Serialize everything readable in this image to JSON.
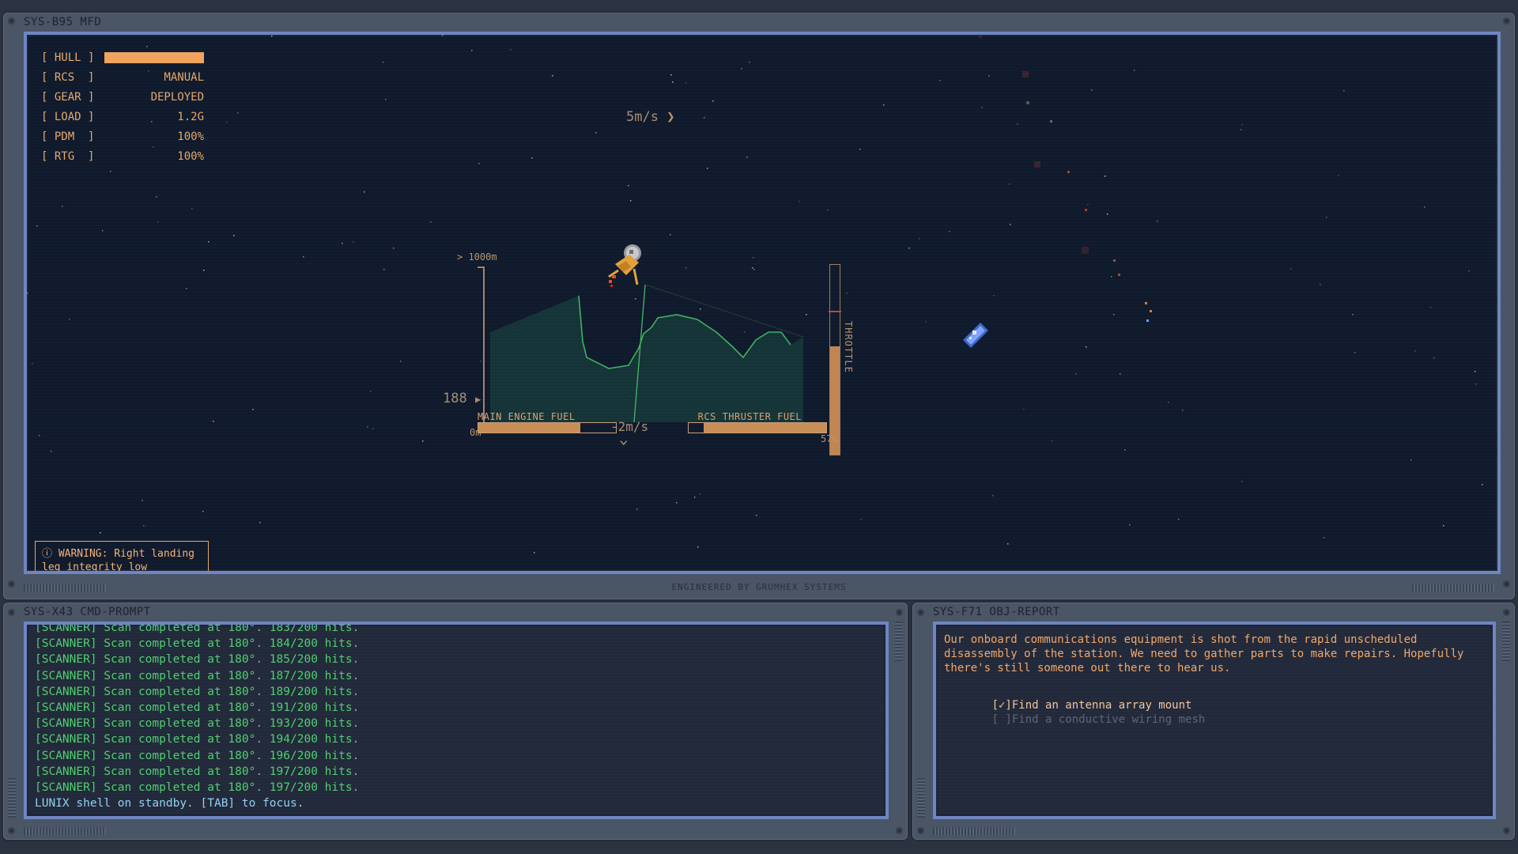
{
  "mfd": {
    "title": "SYS-B95 MFD",
    "footer": "ENGINEERED BY GRUMHEX SYSTEMS",
    "status": [
      {
        "key": "[ HULL ]",
        "value": ""
      },
      {
        "key": "[ RCS  ]",
        "value": "MANUAL"
      },
      {
        "key": "[ GEAR ]",
        "value": "DEPLOYED"
      },
      {
        "key": "[ LOAD ]",
        "value": "1.2G"
      },
      {
        "key": "[ PDM  ]",
        "value": "100%"
      },
      {
        "key": "[ RTG  ]",
        "value": "100%"
      }
    ],
    "hull_level": 1.0,
    "horizontal_speed": "5m/s",
    "vertical_speed": "-2m/s",
    "altitude_max": "> 1000m",
    "altitude_current": "188",
    "altitude_min": "0m",
    "main_fuel_label": "MAIN ENGINE FUEL",
    "main_fuel_level": 0.74,
    "rcs_fuel_label": "RCS THRUSTER FUEL",
    "rcs_fuel_level": 0.89,
    "throttle_label": "THROTTLE",
    "throttle_value": "57%",
    "throttle_level": 0.57,
    "warning_icon": "alert-circle-icon",
    "warning_text": "ⓘ WARNING: Right landing leg integrity low"
  },
  "cmd": {
    "title": "SYS-X43 CMD-PROMPT",
    "log": [
      "[SCANNER] Scan completed at 180°. 183/200 hits.",
      "[SCANNER] Scan completed at 180°. 184/200 hits.",
      "[SCANNER] Scan completed at 180°. 185/200 hits.",
      "[SCANNER] Scan completed at 180°. 187/200 hits.",
      "[SCANNER] Scan completed at 180°. 189/200 hits.",
      "[SCANNER] Scan completed at 180°. 191/200 hits.",
      "[SCANNER] Scan completed at 180°. 193/200 hits.",
      "[SCANNER] Scan completed at 180°. 194/200 hits.",
      "[SCANNER] Scan completed at 180°. 196/200 hits.",
      "[SCANNER] Scan completed at 180°. 197/200 hits.",
      "[SCANNER] Scan completed at 180°. 197/200 hits."
    ],
    "shell": "LUNIX shell on standby. [TAB] to focus."
  },
  "obj": {
    "title": "SYS-F71 OBJ-REPORT",
    "report": "Our onboard communications equipment is shot from the rapid unscheduled disassembly of the station. We need to gather parts to make repairs. Hopefully there's still someone out there to hear us.",
    "tasks": [
      {
        "mark": "[✓]",
        "text": "Find an antenna array mount",
        "done": true
      },
      {
        "mark": "[ ]",
        "text": "Find a conductive wiring mesh",
        "done": false
      }
    ]
  },
  "colors": {
    "accent": "#e7a86b",
    "terrain_line": "#3fb060",
    "log_text": "#4ed06f",
    "screen_border": "#6e86c2"
  }
}
